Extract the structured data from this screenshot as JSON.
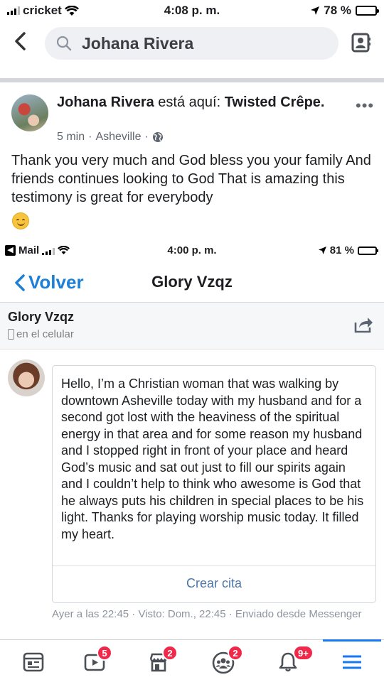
{
  "status_bar": {
    "carrier": "cricket",
    "time": "4:08 p. m.",
    "battery": "78 %",
    "battery_level": 0.78
  },
  "search": {
    "query": "Johana Rivera"
  },
  "post": {
    "author": "Johana Rivera",
    "checkin_prefix": "está aquí:",
    "place": "Twisted Crêpe.",
    "time": "5 min",
    "location": "Asheville",
    "body": "Thank you very much and God bless you your family And friends continues looking to God That is amazing this testimony is great for everybody",
    "emoji": "smiling-face"
  },
  "embedded": {
    "status_bar": {
      "app": "Mail",
      "time": "4:00 p. m.",
      "battery": "81 %",
      "battery_level": 0.81
    },
    "nav": {
      "back_label": "Volver",
      "title": "Glory Vzqz"
    },
    "chat_header": {
      "name": "Glory Vzqz",
      "subtitle": "en el celular"
    },
    "message": "Hello, I’m a Christian woman that was walking by downtown Asheville today with my husband and for a second got lost with the heaviness of the spiritual energy in that area and for some reason my husband and I stopped right in front of your place and heard God’s music and sat out just to fill our spirits again and I couldn’t help to think who awesome is God that he always puts his children in special places to be his light. Thanks for playing worship music today. It filled my heart.",
    "action": "Crear cita",
    "meta": "Ayer a las 22:45 · Visto: Dom., 22:45 · Enviado desde Messenger"
  },
  "tabs": [
    {
      "name": "news-feed",
      "badge": ""
    },
    {
      "name": "watch",
      "badge": "5"
    },
    {
      "name": "marketplace",
      "badge": "2"
    },
    {
      "name": "groups",
      "badge": "2"
    },
    {
      "name": "notifications",
      "badge": "9+"
    },
    {
      "name": "menu",
      "badge": ""
    }
  ],
  "colors": {
    "accent": "#1877f2",
    "badge": "#f02849",
    "link": "#1d7fd6"
  }
}
